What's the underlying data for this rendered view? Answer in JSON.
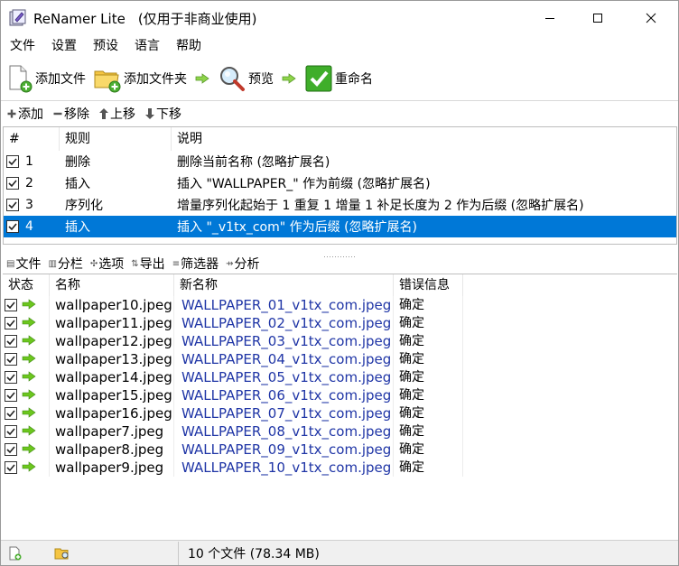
{
  "window": {
    "title": "ReNamer Lite",
    "subtitle": "(仅用于非商业使用)"
  },
  "menu": [
    "文件",
    "设置",
    "预设",
    "语言",
    "帮助"
  ],
  "toolbar": {
    "add_files": "添加文件",
    "add_folders": "添加文件夹",
    "preview": "预览",
    "rename": "重命名"
  },
  "rule_tools": {
    "add": "添加",
    "remove": "移除",
    "move_up": "上移",
    "move_down": "下移"
  },
  "rules": {
    "headers": [
      "#",
      "规则",
      "说明"
    ],
    "rows": [
      {
        "num": "1",
        "rule": "删除",
        "desc": "删除当前名称 (忽略扩展名)",
        "checked": true,
        "selected": false
      },
      {
        "num": "2",
        "rule": "插入",
        "desc": "插入 \"WALLPAPER_\" 作为前缀 (忽略扩展名)",
        "checked": true,
        "selected": false
      },
      {
        "num": "3",
        "rule": "序列化",
        "desc": "增量序列化起始于 1 重复 1 增量 1 补足长度为 2 作为后缀 (忽略扩展名)",
        "checked": true,
        "selected": false
      },
      {
        "num": "4",
        "rule": "插入",
        "desc": "插入 \"_v1tx_com\" 作为后缀 (忽略扩展名)",
        "checked": true,
        "selected": true
      }
    ]
  },
  "files_tools": {
    "files": "文件",
    "columns": "分栏",
    "options": "选项",
    "export": "导出",
    "filter": "筛选器",
    "analyze": "分析"
  },
  "files": {
    "headers": [
      "状态",
      "名称",
      "新名称",
      "错误信息"
    ],
    "rows": [
      {
        "name": "wallpaper10.jpeg",
        "new_name": "WALLPAPER_01_v1tx_com.jpeg",
        "error": "确定"
      },
      {
        "name": "wallpaper11.jpeg",
        "new_name": "WALLPAPER_02_v1tx_com.jpeg",
        "error": "确定"
      },
      {
        "name": "wallpaper12.jpeg",
        "new_name": "WALLPAPER_03_v1tx_com.jpeg",
        "error": "确定"
      },
      {
        "name": "wallpaper13.jpeg",
        "new_name": "WALLPAPER_04_v1tx_com.jpeg",
        "error": "确定"
      },
      {
        "name": "wallpaper14.jpeg",
        "new_name": "WALLPAPER_05_v1tx_com.jpeg",
        "error": "确定"
      },
      {
        "name": "wallpaper15.jpeg",
        "new_name": "WALLPAPER_06_v1tx_com.jpeg",
        "error": "确定"
      },
      {
        "name": "wallpaper16.jpeg",
        "new_name": "WALLPAPER_07_v1tx_com.jpeg",
        "error": "确定"
      },
      {
        "name": "wallpaper7.jpeg",
        "new_name": "WALLPAPER_08_v1tx_com.jpeg",
        "error": "确定"
      },
      {
        "name": "wallpaper8.jpeg",
        "new_name": "WALLPAPER_09_v1tx_com.jpeg",
        "error": "确定"
      },
      {
        "name": "wallpaper9.jpeg",
        "new_name": "WALLPAPER_10_v1tx_com.jpeg",
        "error": "确定"
      }
    ]
  },
  "status": {
    "summary": "10 个文件 (78.34 MB)"
  },
  "colors": {
    "selection": "#0078d7",
    "new_name_text": "#1f35a6",
    "status_arrow": "#6cc61e"
  }
}
